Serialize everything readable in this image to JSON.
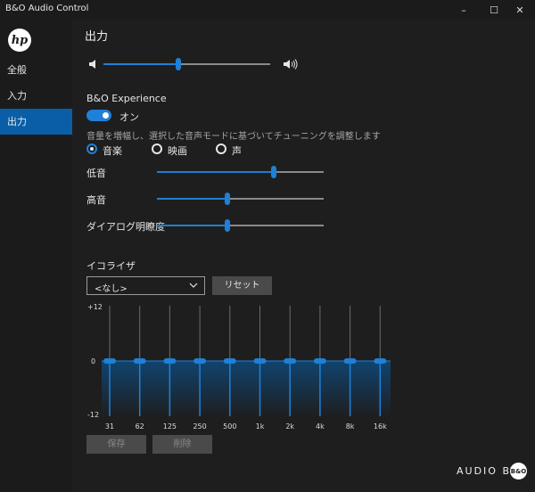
{
  "window": {
    "title": "B&O Audio Control",
    "controls": [
      "–",
      "☐",
      "✕"
    ]
  },
  "sidebar": {
    "logo_text": "hp",
    "items": [
      {
        "label": "全般",
        "active": false
      },
      {
        "label": "入力",
        "active": false
      },
      {
        "label": "出力",
        "active": true
      }
    ]
  },
  "page": {
    "title": "出力"
  },
  "volume": {
    "level": 0.45,
    "icon_low": "speaker-low-icon",
    "icon_high": "speaker-high-icon"
  },
  "bo_experience": {
    "label": "B&O Experience",
    "toggle_label": "オン",
    "enabled": true,
    "description": "音量を増幅し、選択した音声モードに基づいてチューニングを調整します",
    "modes": [
      {
        "label": "音楽",
        "checked": true
      },
      {
        "label": "映画",
        "checked": false
      },
      {
        "label": "声",
        "checked": false
      }
    ],
    "controls": [
      {
        "label": "低音",
        "level": 0.7
      },
      {
        "label": "高音",
        "level": 0.42
      },
      {
        "label": "ダイアログ明瞭度",
        "level": 0.42
      }
    ]
  },
  "equalizer": {
    "label": "イコライザ",
    "preset_value": "<なし>",
    "reset_label": "リセット",
    "scale": {
      "max": "+12",
      "mid": "0",
      "min": "-12"
    },
    "bands": [
      {
        "freq": "31",
        "gain": 0
      },
      {
        "freq": "62",
        "gain": 0
      },
      {
        "freq": "125",
        "gain": 0
      },
      {
        "freq": "250",
        "gain": 0
      },
      {
        "freq": "500",
        "gain": 0
      },
      {
        "freq": "1k",
        "gain": 0
      },
      {
        "freq": "2k",
        "gain": 0
      },
      {
        "freq": "4k",
        "gain": 0
      },
      {
        "freq": "8k",
        "gain": 0
      },
      {
        "freq": "16k",
        "gain": 0
      }
    ],
    "save_label": "保存",
    "delete_label": "削除"
  },
  "brand": {
    "text": "AUDIO BY",
    "logo_text": "B&O"
  },
  "colors": {
    "accent": "#1e80d8",
    "active_nav": "#0a5ea8",
    "background": "#1e1e1e"
  }
}
